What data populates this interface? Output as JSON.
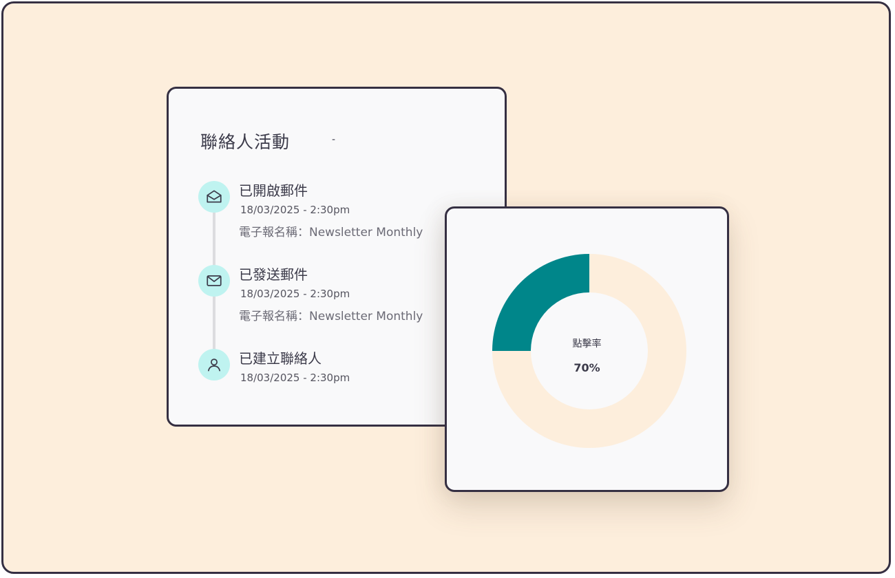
{
  "activity": {
    "title": "聯絡人活動",
    "title_suffix": "-",
    "items": [
      {
        "icon": "mail-open-icon",
        "title": "已開啟郵件",
        "time": "18/03/2025 - 2:30pm",
        "detail": "電子報名稱：Newsletter Monthly"
      },
      {
        "icon": "mail-icon",
        "title": "已發送郵件",
        "time": "18/03/2025 - 2:30pm",
        "detail": "電子報名稱：Newsletter Monthly"
      },
      {
        "icon": "user-icon",
        "title": "已建立聯絡人",
        "time": "18/03/2025 - 2:30pm"
      }
    ]
  },
  "chart": {
    "label": "點擊率",
    "value_text": "70%"
  },
  "chart_data": {
    "type": "pie",
    "variant": "donut",
    "center_label": "點擊率",
    "center_value": "70%",
    "slices": [
      {
        "value": 25,
        "color": "#00868a"
      },
      {
        "value": 75,
        "color": "#fdeedc"
      }
    ]
  },
  "colors": {
    "background": "#fdeedc",
    "card": "#f9f9fa",
    "border": "#352f42",
    "accent": "#00868a",
    "icon_bg": "#bff3f0"
  }
}
